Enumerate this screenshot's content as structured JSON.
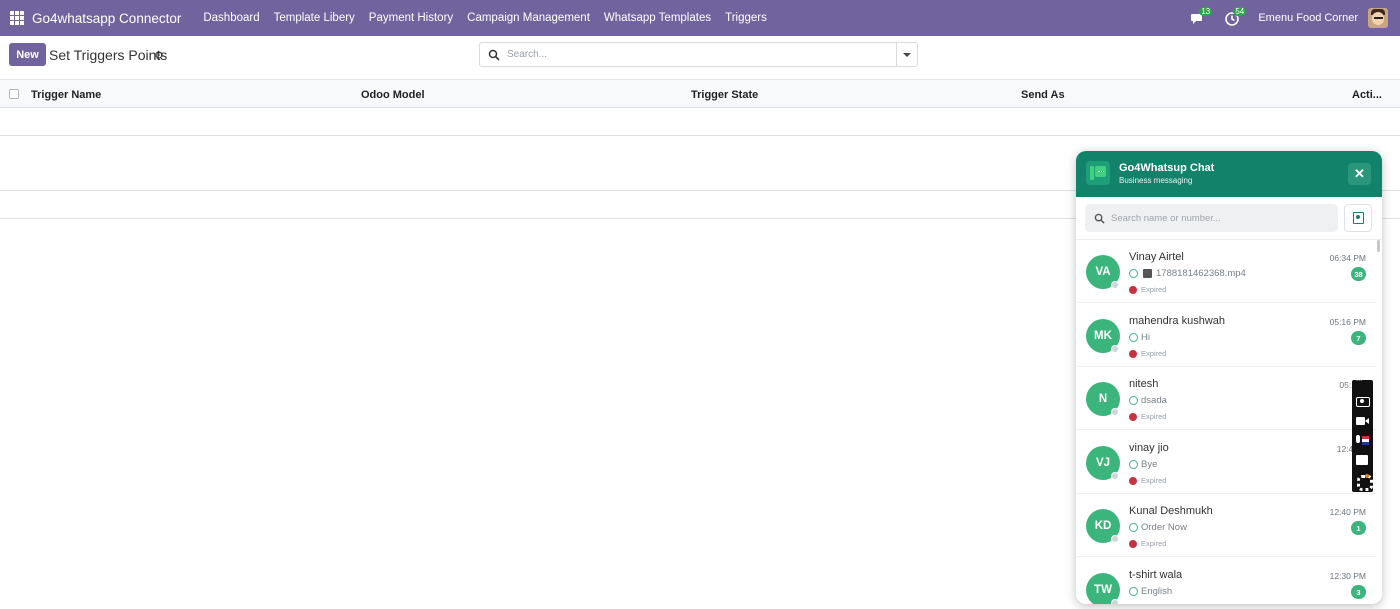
{
  "navbar": {
    "brand": "Go4whatsapp Connector",
    "items": [
      "Dashboard",
      "Template Libery",
      "Payment History",
      "Campaign Management",
      "Whatsapp Templates",
      "Triggers"
    ],
    "messages_badge": "13",
    "activity_badge": "54",
    "company": "Emenu Food Corner"
  },
  "control": {
    "new_label": "New",
    "title": "Set Triggers Points",
    "search_placeholder": "Search..."
  },
  "table": {
    "columns": [
      "Trigger Name",
      "Odoo Model",
      "Trigger State",
      "Send As",
      "Acti..."
    ]
  },
  "chat": {
    "title": "Go4Whatsup Chat",
    "subtitle": "Business messaging",
    "search_placeholder": "Search name or number...",
    "items": [
      {
        "initials": "VA",
        "name": "Vinay Airtel",
        "time": "06:34 PM",
        "message": "1788181462368.mp4",
        "status": "Expired",
        "badge": "38"
      },
      {
        "initials": "MK",
        "name": "mahendra kushwah",
        "time": "05:16 PM",
        "message": "Hi",
        "status": "Expired",
        "badge": "7"
      },
      {
        "initials": "N",
        "name": "nitesh",
        "time": "05:11",
        "message": "dsada",
        "status": "Expired",
        "badge": ""
      },
      {
        "initials": "VJ",
        "name": "vinay jio",
        "time": "12:49",
        "message": "Bye",
        "status": "Expired",
        "badge": ""
      },
      {
        "initials": "KD",
        "name": "Kunal Deshmukh",
        "time": "12:40 PM",
        "message": "Order Now",
        "status": "Expired",
        "badge": "1"
      },
      {
        "initials": "TW",
        "name": "t-shirt wala",
        "time": "12:30 PM",
        "message": "English",
        "status": "",
        "badge": "3"
      }
    ]
  }
}
